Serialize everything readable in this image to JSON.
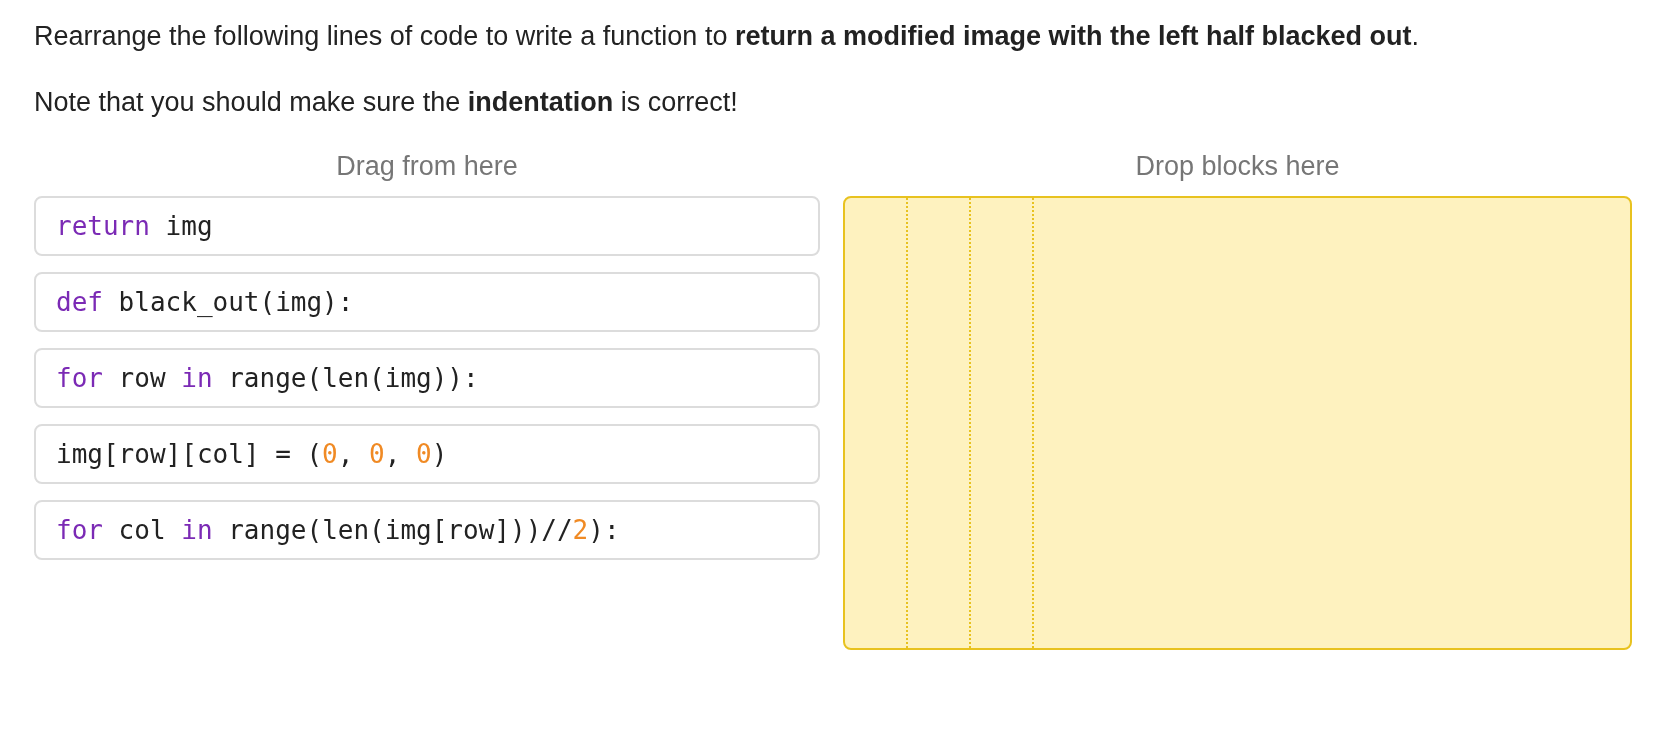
{
  "instructions": [
    "Rearrange the following lines of code to write a function to **return a modified image with the left half blacked out**.",
    "Note that you should make sure the **indentation** is correct!"
  ],
  "source": {
    "heading": "Drag from here",
    "blocks": [
      {
        "tokens": [
          {
            "kind": "keyword",
            "text": "return"
          },
          {
            "kind": "plain",
            "text": " img"
          }
        ]
      },
      {
        "tokens": [
          {
            "kind": "keyword",
            "text": "def"
          },
          {
            "kind": "plain",
            "text": " black_out(img):"
          }
        ]
      },
      {
        "tokens": [
          {
            "kind": "keyword",
            "text": "for"
          },
          {
            "kind": "plain",
            "text": " row "
          },
          {
            "kind": "keyword",
            "text": "in"
          },
          {
            "kind": "plain",
            "text": " range(len(img)):"
          }
        ]
      },
      {
        "tokens": [
          {
            "kind": "plain",
            "text": "img[row][col] = ("
          },
          {
            "kind": "number",
            "text": "0"
          },
          {
            "kind": "plain",
            "text": ", "
          },
          {
            "kind": "number",
            "text": "0"
          },
          {
            "kind": "plain",
            "text": ", "
          },
          {
            "kind": "number",
            "text": "0"
          },
          {
            "kind": "plain",
            "text": ")"
          }
        ]
      },
      {
        "tokens": [
          {
            "kind": "keyword",
            "text": "for"
          },
          {
            "kind": "plain",
            "text": " col "
          },
          {
            "kind": "keyword",
            "text": "in"
          },
          {
            "kind": "plain",
            "text": " range(len(img[row]))//"
          },
          {
            "kind": "number",
            "text": "2"
          },
          {
            "kind": "plain",
            "text": "):"
          }
        ]
      }
    ]
  },
  "target": {
    "heading": "Drop blocks here"
  }
}
